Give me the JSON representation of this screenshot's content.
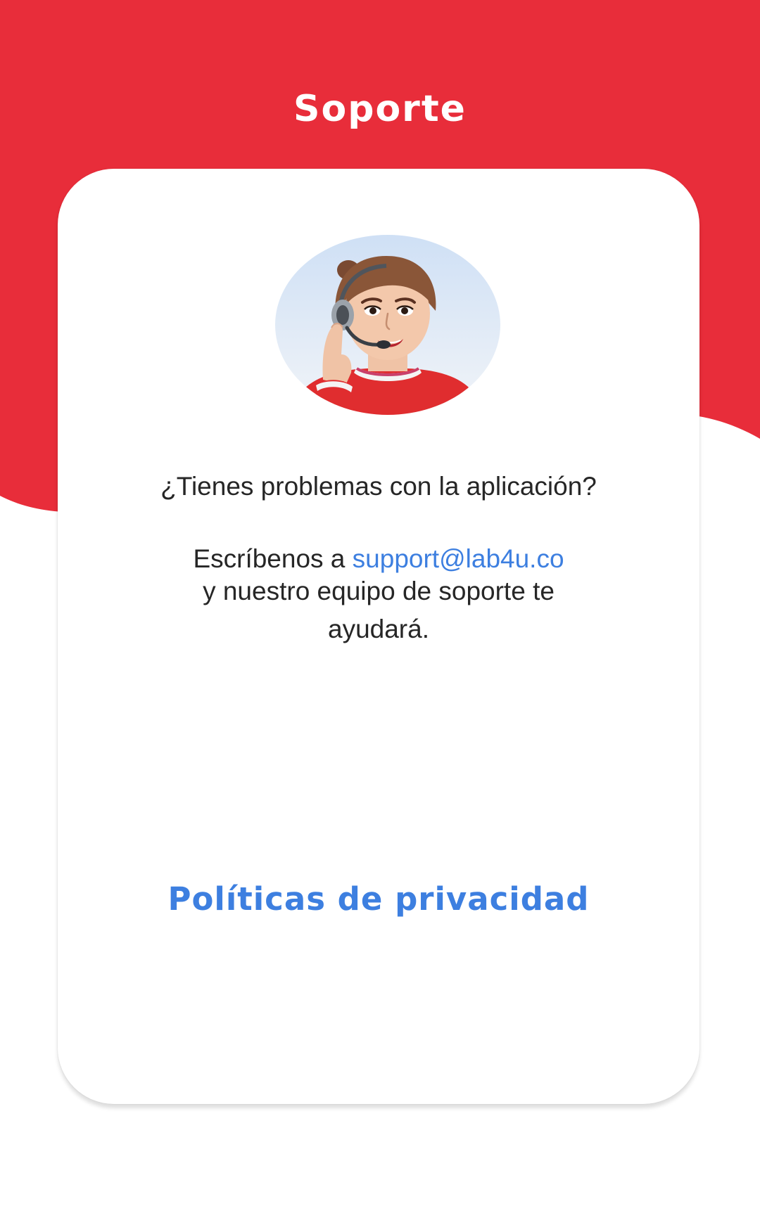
{
  "header": {
    "title": "Soporte"
  },
  "support": {
    "question": "¿Tienes problemas con la aplicación?",
    "write_prefix": "Escríbenos a",
    "email": "support@lab4u.co",
    "message_rest_line1": "y nuestro equipo de soporte te",
    "message_rest_line2": "ayudará."
  },
  "links": {
    "privacy": "Políticas de privacidad"
  },
  "icons": {
    "avatar": "support-agent-avatar-icon"
  },
  "colors": {
    "brand_red": "#E82D3A",
    "link_blue": "#3D7FE0",
    "text": "#262626",
    "card": "#FFFFFF"
  }
}
